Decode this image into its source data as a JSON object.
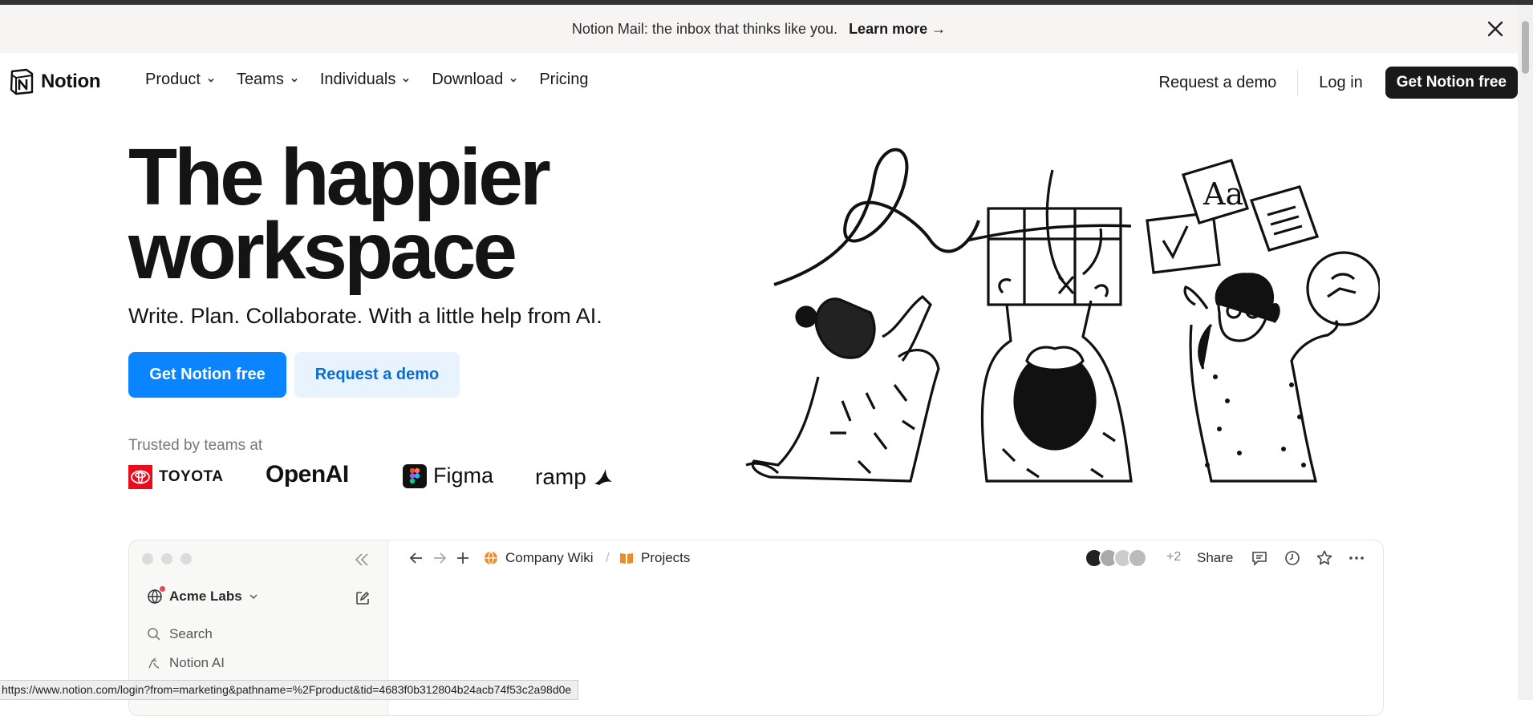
{
  "announcement": {
    "text": "Notion Mail: the inbox that thinks like you.",
    "link": "Learn more →"
  },
  "nav": {
    "brand": "Notion",
    "links": [
      {
        "label": "Product",
        "has_dropdown": true
      },
      {
        "label": "Teams",
        "has_dropdown": true
      },
      {
        "label": "Individuals",
        "has_dropdown": true
      },
      {
        "label": "Download",
        "has_dropdown": true
      },
      {
        "label": "Pricing",
        "has_dropdown": false
      }
    ],
    "request_demo": "Request a demo",
    "login": "Log in",
    "get_free": "Get Notion free"
  },
  "hero": {
    "title_line1": "The happier",
    "title_line2": "workspace",
    "subtitle": "Write. Plan. Collaborate. With a little help from AI.",
    "primary_cta": "Get Notion free",
    "secondary_cta": "Request a demo",
    "trusted_label": "Trusted by teams at",
    "logos": [
      "TOYOTA",
      "OpenAI",
      "Figma",
      "ramp"
    ]
  },
  "app_preview": {
    "workspace": "Acme Labs",
    "sidebar_items": [
      "Search",
      "Notion AI"
    ],
    "breadcrumb": [
      "Company Wiki",
      "Projects"
    ],
    "extra_avatars": "+2",
    "share": "Share"
  },
  "status_url": "https://www.notion.com/login?from=marketing&pathname=%2Fproduct&tid=4683f0b312804b24acb74f53c2a98d0e",
  "colors": {
    "primary_blue": "#0a85ff",
    "secondary_bg": "#e9f3fd",
    "dark_button": "#191919",
    "banner_bg": "#f6f5f4"
  }
}
